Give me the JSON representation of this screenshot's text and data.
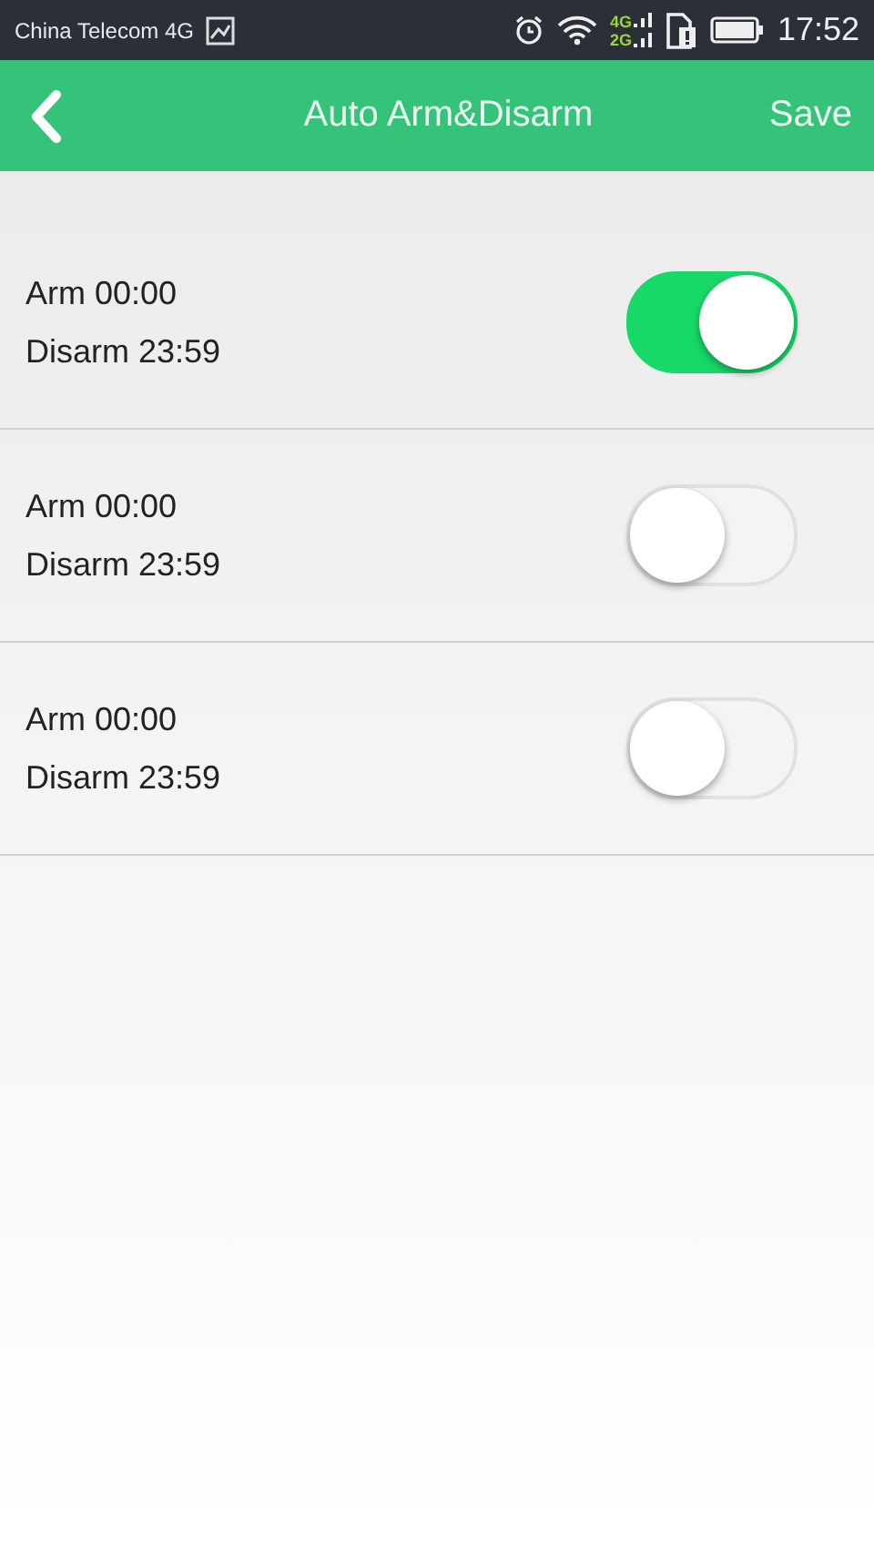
{
  "status_bar": {
    "carrier": "China Telecom 4G",
    "network_labels": [
      "4G",
      "2G"
    ],
    "time": "17:52"
  },
  "header": {
    "title": "Auto Arm&Disarm",
    "action": "Save"
  },
  "schedules": [
    {
      "arm": "Arm 00:00",
      "disarm": "Disarm 23:59",
      "on": true
    },
    {
      "arm": "Arm 00:00",
      "disarm": "Disarm 23:59",
      "on": false
    },
    {
      "arm": "Arm 00:00",
      "disarm": "Disarm 23:59",
      "on": false
    }
  ]
}
